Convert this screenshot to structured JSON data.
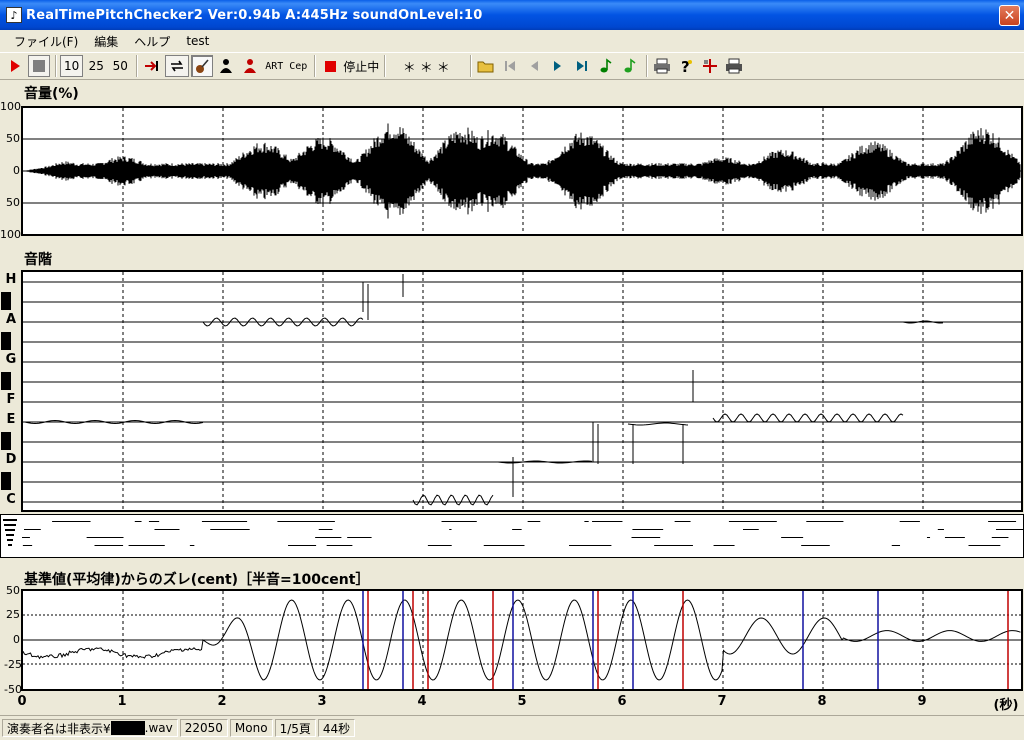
{
  "window": {
    "title": "RealTimePitchChecker2   Ver:0.94b      A:445Hz     soundOnLevel:10",
    "close_glyph": "✕"
  },
  "menu": [
    "ファイル(F)",
    "編集",
    "ヘルプ",
    "test"
  ],
  "toolbar": {
    "speed_10": "10",
    "speed_25": "25",
    "speed_50": "50",
    "art_label": "ART",
    "cep_label": "Cep",
    "stop_status": "停止中",
    "note_display": "＊＊＊"
  },
  "volume_panel": {
    "title": "音量(%)",
    "y_ticks": [
      "100",
      "50",
      "0",
      "50",
      "100"
    ]
  },
  "scale_panel": {
    "title": "音階",
    "notes": [
      "H",
      "A",
      "G",
      "F",
      "E",
      "D",
      "C"
    ]
  },
  "deviation_panel": {
    "title": "基準値(平均律)からのズレ(cent)［半音=100cent］",
    "y_ticks": [
      "50",
      "25",
      "0",
      "-25",
      "-50"
    ]
  },
  "x_axis": {
    "ticks": [
      "0",
      "1",
      "2",
      "3",
      "4",
      "5",
      "6",
      "7",
      "8",
      "9"
    ],
    "unit": "(秒)"
  },
  "status": {
    "performer": "演奏者名は非表示¥",
    "file_ext": ".wav",
    "sample_rate": "22050",
    "channels": "Mono",
    "page": "1/5頁",
    "duration": "44秒"
  },
  "colors": {
    "titlebar": "#0254E3",
    "trace": "#000000",
    "marker_red": "#C00000",
    "marker_blue": "#1010A0"
  }
}
